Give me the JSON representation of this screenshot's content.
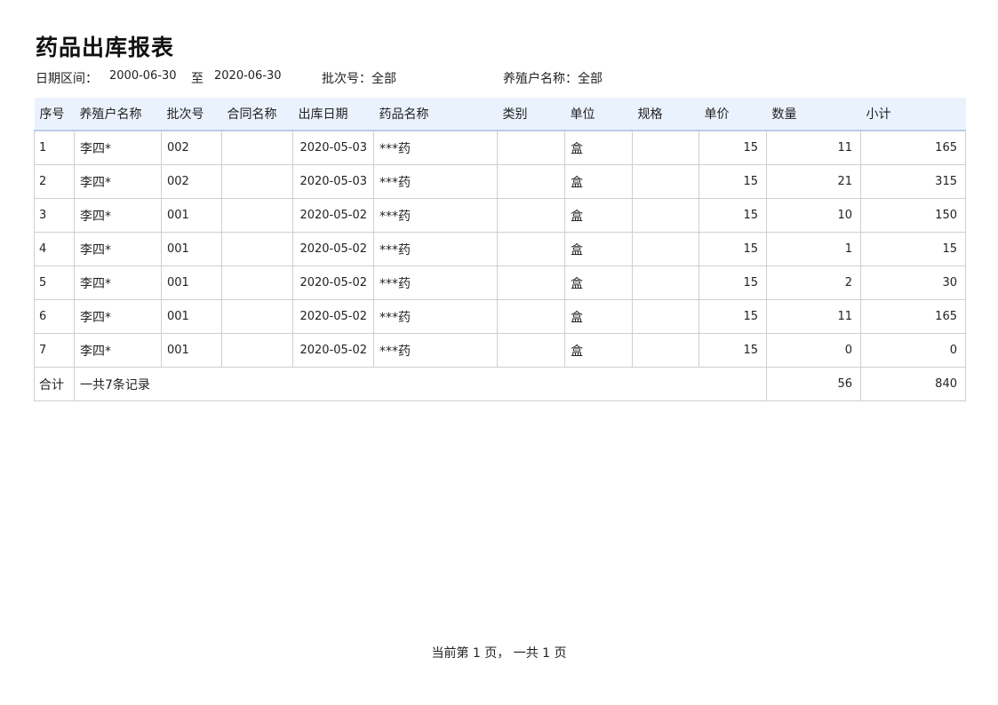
{
  "report": {
    "title": "药品出库报表",
    "date_label": "日期区间：",
    "date_from": "2000-06-30",
    "date_sep": "至",
    "date_to": "2020-06-30",
    "batch_filter": "批次号：全部",
    "farmer_filter": "养殖户名称：全部"
  },
  "table": {
    "headers": [
      "序号",
      "养殖户名称",
      "批次号",
      "合同名称",
      "出库日期",
      "药品名称",
      "类别",
      "单位",
      "规格",
      "单价",
      "数量",
      "小计"
    ],
    "rows": [
      [
        "1",
        "李四*",
        "002",
        "",
        "2020-05-03",
        "***药",
        "",
        "盒",
        "",
        "15",
        "11",
        "165"
      ],
      [
        "2",
        "李四*",
        "002",
        "",
        "2020-05-03",
        "***药",
        "",
        "盒",
        "",
        "15",
        "21",
        "315"
      ],
      [
        "3",
        "李四*",
        "001",
        "",
        "2020-05-02",
        "***药",
        "",
        "盒",
        "",
        "15",
        "10",
        "150"
      ],
      [
        "4",
        "李四*",
        "001",
        "",
        "2020-05-02",
        "***药",
        "",
        "盒",
        "",
        "15",
        "1",
        "15"
      ],
      [
        "5",
        "李四*",
        "001",
        "",
        "2020-05-02",
        "***药",
        "",
        "盒",
        "",
        "15",
        "2",
        "30"
      ],
      [
        "6",
        "李四*",
        "001",
        "",
        "2020-05-02",
        "***药",
        "",
        "盒",
        "",
        "15",
        "11",
        "165"
      ],
      [
        "7",
        "李四*",
        "001",
        "",
        "2020-05-02",
        "***药",
        "",
        "盒",
        "",
        "15",
        "0",
        "0"
      ]
    ],
    "total": {
      "label": "合计",
      "records": "一共7条记录",
      "quantity": "56",
      "subtotal": "840"
    }
  },
  "pager": {
    "text": "当前第 1 页， 一共 1 页"
  }
}
